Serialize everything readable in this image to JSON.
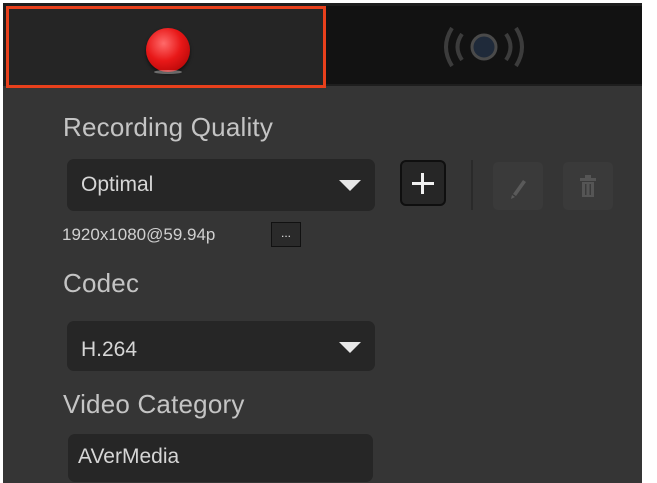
{
  "tabs": {
    "record": {
      "icon": "record-icon",
      "selected": true,
      "highlight_color": "#e8401c"
    },
    "stream": {
      "icon": "broadcast-icon"
    }
  },
  "recording_quality": {
    "label": "Recording Quality",
    "selected": "Optimal",
    "resolution": "1920x1080@59.94p",
    "more_label": "..."
  },
  "codec": {
    "label": "Codec",
    "selected": "H.264"
  },
  "video_category": {
    "label": "Video Category",
    "value": "AVerMedia"
  },
  "colors": {
    "accent": "#e8401c",
    "record_red": "#e81818",
    "panel_bg": "#353535"
  }
}
